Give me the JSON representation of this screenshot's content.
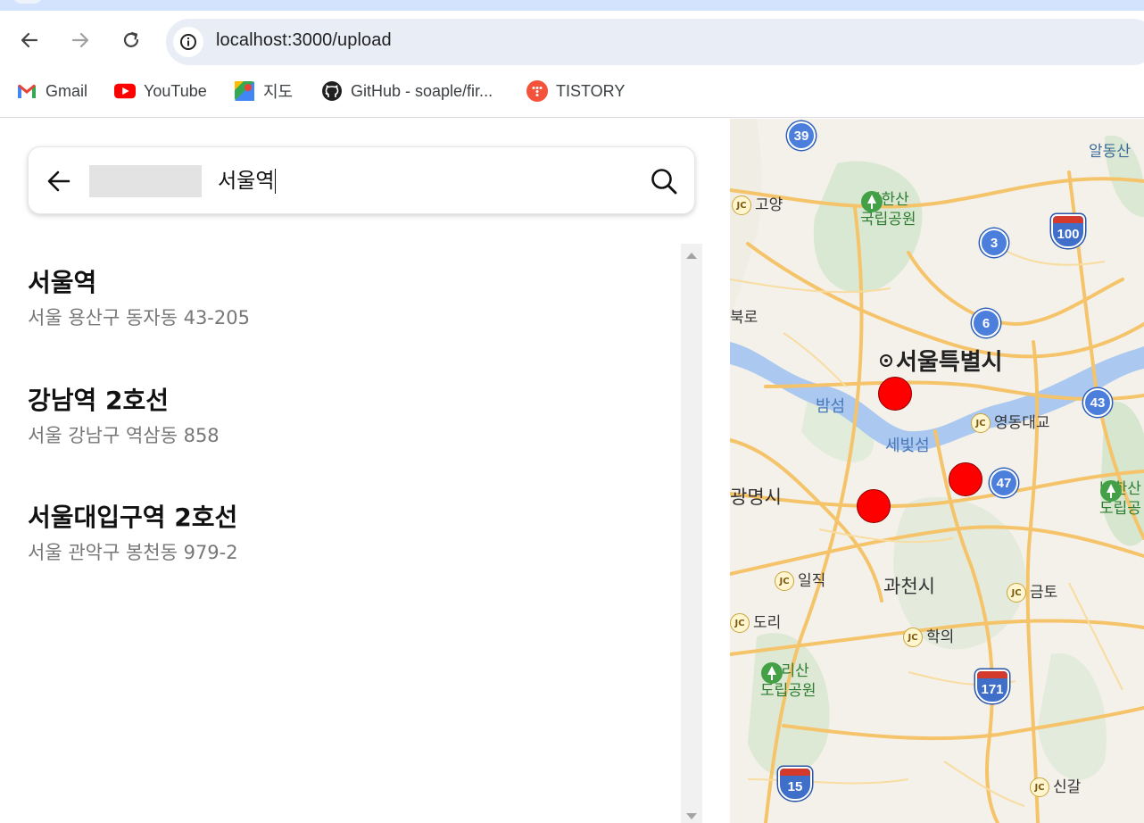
{
  "browser": {
    "url": "localhost:3000/upload",
    "bookmarks": [
      {
        "label": "Gmail",
        "icon": "gmail-icon"
      },
      {
        "label": "YouTube",
        "icon": "youtube-icon"
      },
      {
        "label": "지도",
        "icon": "google-maps-icon"
      },
      {
        "label": "GitHub - soaple/fir...",
        "icon": "github-icon"
      },
      {
        "label": "TISTORY",
        "icon": "tistory-icon"
      }
    ]
  },
  "search": {
    "query": "서울역"
  },
  "results": [
    {
      "title": "서울역",
      "address": "서울 용산구 동자동 43-205"
    },
    {
      "title": "강남역 2호선",
      "address": "서울 강남구 역삼동 858"
    },
    {
      "title": "서울대입구역 2호선",
      "address": "서울 관악구 봉천동 979-2"
    }
  ],
  "map": {
    "labels": {
      "goyang": "고양",
      "bukhansan": "북한산",
      "bukhansan2": "국립공원",
      "seoul": "서울특별시",
      "bamseom": "밤섬",
      "sebitseom": "세빛섬",
      "yeongdong": "영동대교",
      "gwangmyeong": "광명시",
      "iljik": "일직",
      "gwacheon": "과천시",
      "geumto": "금토",
      "dori": "도리",
      "hagui": "학의",
      "surisan": "수리산",
      "surisan2": "도립공원",
      "singal": "신갈",
      "aldongsan": "알동산",
      "namhansan": "남한산",
      "namhansan2": "도립공",
      "bukro": "북로"
    },
    "routes": [
      "39",
      "3",
      "6",
      "43",
      "47"
    ],
    "shields": [
      "100",
      "171",
      "15"
    ],
    "jc_text": "JC",
    "marker_color": "#ff0000"
  }
}
